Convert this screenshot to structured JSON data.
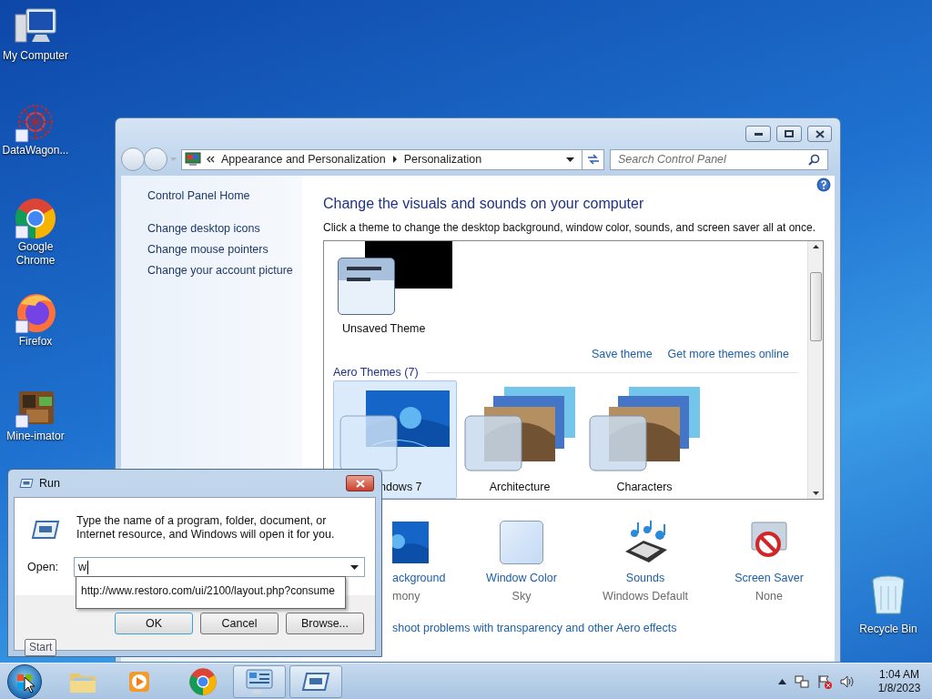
{
  "desktop_icons": [
    {
      "label": "My Computer",
      "kind": "computer"
    },
    {
      "label": "DataWagon...",
      "kind": "datawagon"
    },
    {
      "label": "Google Chrome",
      "kind": "chrome"
    },
    {
      "label": "Firefox",
      "kind": "firefox"
    },
    {
      "label": "Mine-imator",
      "kind": "mineimator"
    },
    {
      "label": "Recycle Bin",
      "kind": "recycle"
    }
  ],
  "control_panel": {
    "breadcrumb": [
      "Appearance and Personalization",
      "Personalization"
    ],
    "search": {
      "placeholder": "Search Control Panel"
    },
    "sidebar": {
      "items": [
        "Control Panel Home",
        "Change desktop icons",
        "Change mouse pointers",
        "Change your account picture"
      ]
    },
    "heading": "Change the visuals and sounds on your computer",
    "description": "Click a theme to change the desktop background, window color, sounds, and screen saver all at once.",
    "my_theme": {
      "label": "Unsaved Theme"
    },
    "links": [
      "Save theme",
      "Get more themes online"
    ],
    "group_label": "Aero Themes (7)",
    "themes": [
      {
        "label": "ndows 7",
        "selected": true,
        "kind": "single"
      },
      {
        "label": "Architecture",
        "selected": false,
        "kind": "stack"
      },
      {
        "label": "Characters",
        "selected": false,
        "kind": "stack"
      }
    ],
    "settings": [
      {
        "label": "ackground",
        "value": "mony",
        "kind": "wallpaper"
      },
      {
        "label": "Window Color",
        "value": "Sky",
        "kind": "color"
      },
      {
        "label": "Sounds",
        "value": "Windows Default",
        "kind": "sounds"
      },
      {
        "label": "Screen Saver",
        "value": "None",
        "kind": "screensaver"
      }
    ],
    "troubleshoot_link": "shoot problems with transparency and other Aero effects"
  },
  "run_dialog": {
    "title": "Run",
    "message": "Type the name of a program, folder, document, or Internet resource, and Windows will open it for you.",
    "open_label": "Open:",
    "open_value": "w",
    "suggestion": "http://www.restoro.com/ui/2100/layout.php?consume",
    "buttons": [
      "OK",
      "Cancel",
      "Browse..."
    ]
  },
  "tooltip": "Start",
  "taskbar": {
    "items": [
      {
        "kind": "explorer",
        "selected": false
      },
      {
        "kind": "media",
        "selected": false
      },
      {
        "kind": "chrome",
        "selected": false
      },
      {
        "kind": "control-panel",
        "selected": true
      },
      {
        "kind": "run",
        "selected": true
      }
    ]
  },
  "clock": {
    "time": "1:04 AM",
    "date": "1/8/2023"
  }
}
